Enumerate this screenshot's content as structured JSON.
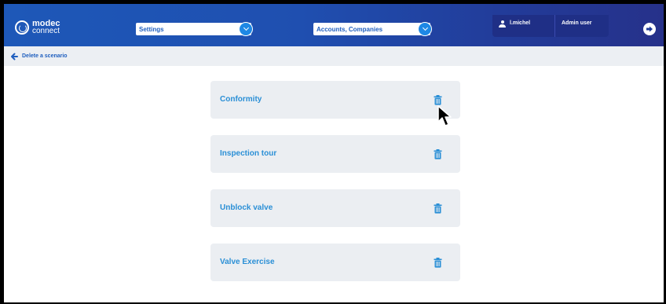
{
  "logo": {
    "line1": "modec",
    "line2": "connect"
  },
  "header": {
    "settings_dropdown": "Settings",
    "accounts_dropdown": "Accounts, Companies",
    "username": "l.michel",
    "role": "Admin user"
  },
  "breadcrumb": {
    "label": "Delete a scenario"
  },
  "scenarios": [
    {
      "label": "Conformity"
    },
    {
      "label": "Inspection tour"
    },
    {
      "label": "Unblock valve"
    },
    {
      "label": "Valve Exercise"
    }
  ],
  "colors": {
    "header_start": "#1e58b8",
    "header_end": "#26318a",
    "accent": "#1e88e5",
    "card_title": "#2a8fd6",
    "card_bg": "#ebeef2"
  },
  "icons": [
    "user-icon",
    "logout-icon",
    "back-arrow-icon",
    "chevron-down-icon",
    "trash-icon"
  ]
}
